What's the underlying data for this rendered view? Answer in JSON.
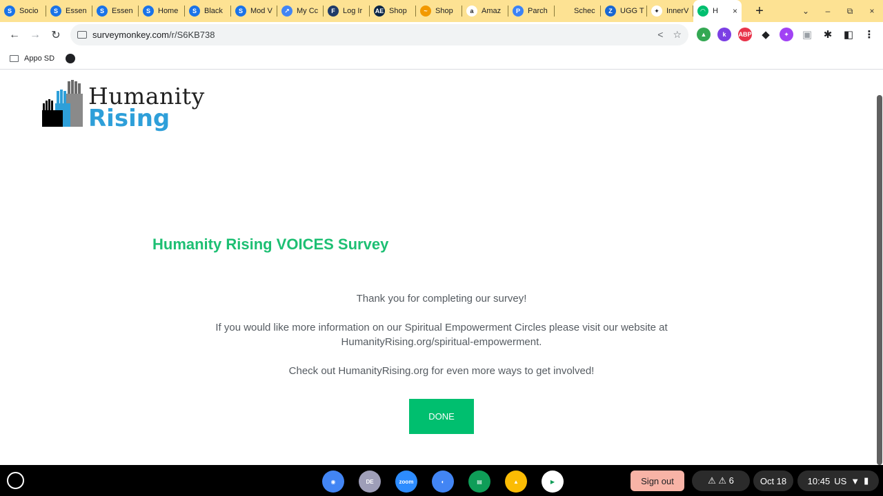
{
  "tabs": [
    {
      "title": "Socio",
      "icon": "s-icon",
      "color": "#1a73e8",
      "glyph": "S"
    },
    {
      "title": "Essen",
      "icon": "s-icon",
      "color": "#1a73e8",
      "glyph": "S"
    },
    {
      "title": "Essen",
      "icon": "s-icon",
      "color": "#1a73e8",
      "glyph": "S"
    },
    {
      "title": "Home",
      "icon": "s-icon",
      "color": "#1a73e8",
      "glyph": "S"
    },
    {
      "title": "Black",
      "icon": "s-icon",
      "color": "#1a73e8",
      "glyph": "S"
    },
    {
      "title": "Mod V",
      "icon": "s-icon",
      "color": "#1a73e8",
      "glyph": "S"
    },
    {
      "title": "My Cc",
      "icon": "app-icon",
      "color": "#4285f4",
      "glyph": "↗"
    },
    {
      "title": "Log Ir",
      "icon": "fsa-icon",
      "color": "#1f3a68",
      "glyph": "F"
    },
    {
      "title": "Shop",
      "icon": "ae-icon",
      "color": "#0b2545",
      "glyph": "AE"
    },
    {
      "title": "Shop",
      "icon": "shop-icon",
      "color": "#f29900",
      "glyph": "~"
    },
    {
      "title": "Amaz",
      "icon": "amazon-icon",
      "color": "#ffffff",
      "glyph": "a"
    },
    {
      "title": "Parch",
      "icon": "parchment-icon",
      "color": "#3b82f6",
      "glyph": "P"
    },
    {
      "title": "Schec",
      "icon": "schedule-icon",
      "color": "#fde293",
      "glyph": ""
    },
    {
      "title": "UGG T",
      "icon": "z-icon",
      "color": "#1967d2",
      "glyph": "Z"
    },
    {
      "title": "InnerV",
      "icon": "innerv-icon",
      "color": "#ffffff",
      "glyph": "✦"
    }
  ],
  "active_tab": {
    "title": "H",
    "close": "×",
    "color": "#00bf6f"
  },
  "new_tab": "+",
  "window_controls": [
    "⌄",
    "–",
    "⧉",
    "×"
  ],
  "toolbar": {
    "back": "←",
    "forward": "→",
    "reload": "↻",
    "url_host": "surveymonkey.com",
    "url_path": "/r/S6KB738",
    "share": "<",
    "star": "☆"
  },
  "extensions": [
    {
      "name": "google-drive-icon",
      "color": "#34a853",
      "glyph": "▲"
    },
    {
      "name": "k-extension-icon",
      "color": "#7b3fe4",
      "glyph": "k"
    },
    {
      "name": "adblock-plus-icon",
      "color": "#e8334a",
      "glyph": "ABP"
    },
    {
      "name": "spy-extension-icon",
      "color": "#202124",
      "glyph": "◆"
    },
    {
      "name": "puzzle-purple-icon",
      "color": "#a142f4",
      "glyph": "✦"
    },
    {
      "name": "copy-extension-icon",
      "color": "#9aa0a6",
      "glyph": "▣"
    },
    {
      "name": "extensions-puzzle-icon",
      "color": "#202124",
      "glyph": "✱"
    },
    {
      "name": "side-panel-icon",
      "color": "#202124",
      "glyph": "◧"
    },
    {
      "name": "menu-icon",
      "color": "#202124",
      "glyph": "⋮"
    }
  ],
  "bookmarks": [
    {
      "label": "Appo SD",
      "icon": "folder-icon"
    },
    {
      "label": "",
      "icon": "globe-icon"
    }
  ],
  "logo": {
    "line1": "Humanity",
    "line2": "Rising",
    "accent": "#2e9fd9"
  },
  "survey": {
    "title": "Humanity Rising VOICES Survey",
    "thanks": "Thank you for completing our survey!",
    "info_line1": "If you would like more information on our Spiritual Empowerment Circles please visit our website at",
    "info_line2": "HumanityRising.org/spiritual-empowerment.",
    "check_out": "Check out HumanityRising.org for even more ways to get involved!",
    "done_label": "DONE",
    "accent": "#00bf6f"
  },
  "shelf": {
    "apps": [
      {
        "name": "chrome-icon",
        "color": "#4285f4",
        "glyph": "◉"
      },
      {
        "name": "profile-app-icon",
        "color": "#9e9eb8",
        "glyph": "DE"
      },
      {
        "name": "zoom-icon",
        "color": "#2d8cff",
        "glyph": "zoom"
      },
      {
        "name": "palette-icon",
        "color": "#4285f4",
        "glyph": "◐"
      },
      {
        "name": "classroom-icon",
        "color": "#0f9d58",
        "glyph": "▤"
      },
      {
        "name": "google-drive-icon",
        "color": "#fbbc04",
        "glyph": "▲"
      },
      {
        "name": "play-store-icon",
        "color": "#ffffff",
        "glyph": "▶"
      }
    ],
    "sign_out": "Sign out",
    "notifications": "⚠ ⚠ 6",
    "date": "Oct 18",
    "time": "10:45",
    "locale": "US"
  }
}
